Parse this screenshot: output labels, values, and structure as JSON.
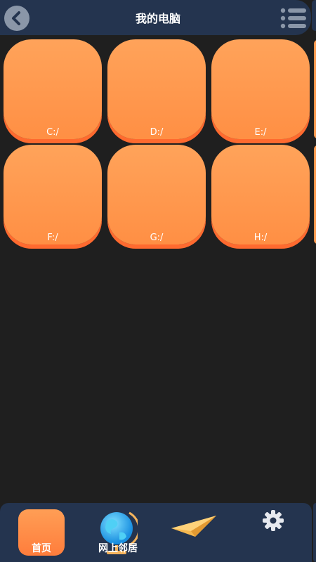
{
  "header": {
    "title": "我的电脑"
  },
  "drives": [
    {
      "label": "C:/"
    },
    {
      "label": "D:/"
    },
    {
      "label": "E:/"
    },
    {
      "label": "F:/"
    },
    {
      "label": "G:/"
    },
    {
      "label": "H:/"
    }
  ],
  "bottom_nav": {
    "home_label": "首页",
    "network_label": "网上邻居"
  },
  "colors": {
    "header_bg": "#24344f",
    "tile_orange": "#ff9a4f",
    "tile_shadow": "#ff6a2f",
    "page_bg": "#1f1f1f"
  },
  "icons": [
    "back-arrow-icon",
    "list-menu-icon",
    "globe-icon",
    "paper-plane-icon",
    "gear-icon"
  ]
}
